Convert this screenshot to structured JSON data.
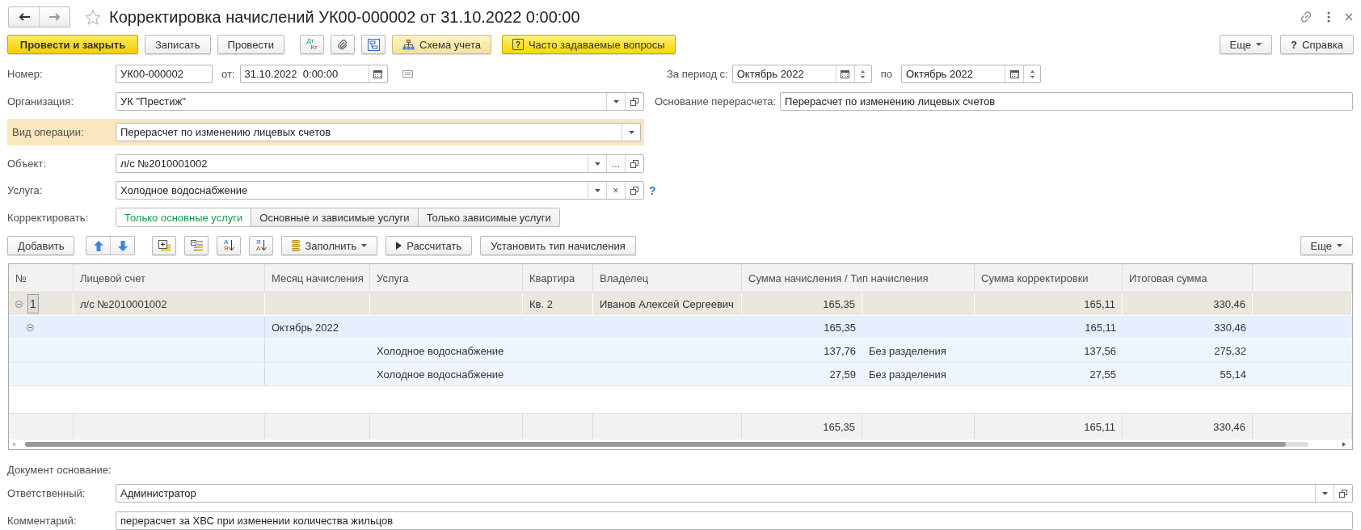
{
  "window": {
    "title": "Корректировка начислений УК00-000002 от 31.10.2022 0:00:00"
  },
  "toolbar": {
    "items": [
      {
        "kind": "primary",
        "label": "Провести и закрыть"
      },
      {
        "kind": "button",
        "label": "Записать"
      },
      {
        "kind": "button",
        "label": "Провести"
      },
      {
        "kind": "dtkt",
        "top": "Дт",
        "bottom": "Кт"
      },
      {
        "kind": "clip"
      },
      {
        "kind": "structure"
      },
      {
        "kind": "scheme",
        "label": "Схема учета"
      },
      {
        "kind": "faq",
        "icon": "?",
        "label": "Часто задаваемые вопросы"
      }
    ],
    "more": "Еще",
    "help": {
      "icon": "?",
      "label": "Справка"
    }
  },
  "header": {
    "number": {
      "label": "Номер:",
      "value": "УК00-000002"
    },
    "date": {
      "label": "от:",
      "value": "31.10.2022  0:00:00"
    },
    "period": {
      "label": "За период с:",
      "from": "Октябрь 2022",
      "to_label": "по",
      "to": "Октябрь 2022"
    },
    "organization": {
      "label": "Организация:",
      "value": "УК \"Престиж\""
    },
    "basis": {
      "label": "Основание перерасчета:",
      "value": "Перерасчет по изменению лицевых счетов"
    },
    "operation": {
      "label": "Вид операции:",
      "value": "Перерасчет по изменению лицевых счетов",
      "highlighted": true
    },
    "object": {
      "label": "Объект:",
      "value": "л/с №2010001002",
      "select_button": "..."
    },
    "service": {
      "label": "Услуга:",
      "value": "Холодное водоснабжение",
      "clear_button": "×",
      "help": "?"
    },
    "correct": {
      "label": "Корректировать:",
      "options": [
        {
          "label": "Только основные услуги",
          "selected": true
        },
        {
          "label": "Основные и зависимые услуги",
          "selected": false
        },
        {
          "label": "Только зависимые услуги",
          "selected": false
        }
      ]
    }
  },
  "table_toolbar": {
    "items": [
      {
        "kind": "button",
        "label": "Добавить"
      },
      {
        "kind": "move"
      },
      {
        "kind": "add-group"
      },
      {
        "kind": "list"
      },
      {
        "kind": "sort",
        "top": "А",
        "bottom": "Я"
      },
      {
        "kind": "sort",
        "top": "Я",
        "bottom": "А"
      },
      {
        "kind": "menu",
        "label": "Заполнить"
      },
      {
        "kind": "run",
        "label": "Рассчитать"
      },
      {
        "kind": "button",
        "label": "Установить тип начисления"
      }
    ],
    "more": "Еще"
  },
  "table": {
    "columns": [
      "№",
      "Лицевой счет",
      "Месяц начисления",
      "Услуга",
      "Квартира",
      "Владелец",
      "Сумма начисления / Тип начисления",
      "Сумма корректировки",
      "Итоговая сумма"
    ],
    "rows": [
      {
        "number": "1",
        "account": "л/с №2010001002",
        "apartment": "Кв. 2",
        "owner": "Иванов Алексей Сергеевич",
        "sum": "165,35",
        "correction": "165,11",
        "total": "330,46",
        "expanded": true,
        "children": [
          {
            "month": "Октябрь 2022",
            "sum": "165,35",
            "correction": "165,11",
            "total": "330,46",
            "expanded": true,
            "children": [
              {
                "service": "Холодное водоснабжение",
                "sum": "137,76",
                "type": "Без разделения",
                "correction": "137,56",
                "total": "275,32"
              },
              {
                "service": "Холодное водоснабжение",
                "sum": "27,59",
                "type": "Без разделения",
                "correction": "27,55",
                "total": "55,14"
              }
            ]
          }
        ]
      }
    ],
    "totals": {
      "sum": "165,35",
      "correction": "165,11",
      "total": "330,46"
    }
  },
  "footer": {
    "basis_label": "Документ основание:",
    "responsible": {
      "label": "Ответственный:",
      "value": "Администратор"
    },
    "comment": {
      "label": "Комментарий:",
      "value": "перерасчет за ХВС при изменении количества жильцов"
    }
  }
}
